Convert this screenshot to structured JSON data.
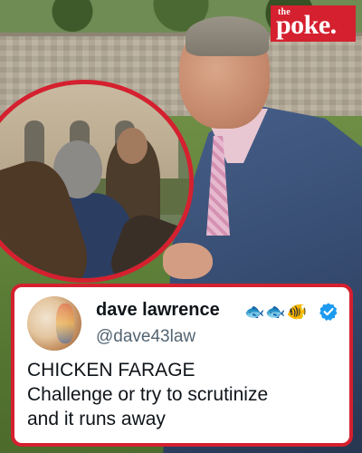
{
  "logo": {
    "line1": "the",
    "line2": "poke."
  },
  "tweet": {
    "display_name": "dave lawrence",
    "name_emojis": [
      "fish-icon",
      "fish-icon",
      "tropical-fish-icon"
    ],
    "verified": true,
    "handle": "@dave43law",
    "text_lines": [
      "CHICKEN FARAGE",
      "Challenge or try to scrutinize",
      "and it runs away"
    ]
  },
  "colors": {
    "brand_red": "#d5202f",
    "verified_blue": "#1d9bf0"
  }
}
